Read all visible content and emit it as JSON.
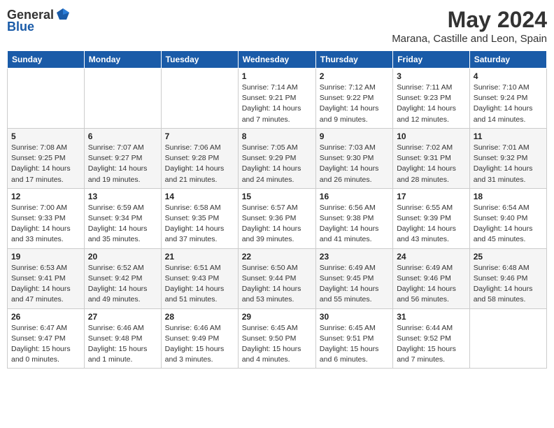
{
  "header": {
    "logo_general": "General",
    "logo_blue": "Blue",
    "month_year": "May 2024",
    "location": "Marana, Castille and Leon, Spain"
  },
  "weekdays": [
    "Sunday",
    "Monday",
    "Tuesday",
    "Wednesday",
    "Thursday",
    "Friday",
    "Saturday"
  ],
  "weeks": [
    [
      {
        "day": "",
        "sunrise": "",
        "sunset": "",
        "daylight": ""
      },
      {
        "day": "",
        "sunrise": "",
        "sunset": "",
        "daylight": ""
      },
      {
        "day": "",
        "sunrise": "",
        "sunset": "",
        "daylight": ""
      },
      {
        "day": "1",
        "sunrise": "Sunrise: 7:14 AM",
        "sunset": "Sunset: 9:21 PM",
        "daylight": "Daylight: 14 hours and 7 minutes."
      },
      {
        "day": "2",
        "sunrise": "Sunrise: 7:12 AM",
        "sunset": "Sunset: 9:22 PM",
        "daylight": "Daylight: 14 hours and 9 minutes."
      },
      {
        "day": "3",
        "sunrise": "Sunrise: 7:11 AM",
        "sunset": "Sunset: 9:23 PM",
        "daylight": "Daylight: 14 hours and 12 minutes."
      },
      {
        "day": "4",
        "sunrise": "Sunrise: 7:10 AM",
        "sunset": "Sunset: 9:24 PM",
        "daylight": "Daylight: 14 hours and 14 minutes."
      }
    ],
    [
      {
        "day": "5",
        "sunrise": "Sunrise: 7:08 AM",
        "sunset": "Sunset: 9:25 PM",
        "daylight": "Daylight: 14 hours and 17 minutes."
      },
      {
        "day": "6",
        "sunrise": "Sunrise: 7:07 AM",
        "sunset": "Sunset: 9:27 PM",
        "daylight": "Daylight: 14 hours and 19 minutes."
      },
      {
        "day": "7",
        "sunrise": "Sunrise: 7:06 AM",
        "sunset": "Sunset: 9:28 PM",
        "daylight": "Daylight: 14 hours and 21 minutes."
      },
      {
        "day": "8",
        "sunrise": "Sunrise: 7:05 AM",
        "sunset": "Sunset: 9:29 PM",
        "daylight": "Daylight: 14 hours and 24 minutes."
      },
      {
        "day": "9",
        "sunrise": "Sunrise: 7:03 AM",
        "sunset": "Sunset: 9:30 PM",
        "daylight": "Daylight: 14 hours and 26 minutes."
      },
      {
        "day": "10",
        "sunrise": "Sunrise: 7:02 AM",
        "sunset": "Sunset: 9:31 PM",
        "daylight": "Daylight: 14 hours and 28 minutes."
      },
      {
        "day": "11",
        "sunrise": "Sunrise: 7:01 AM",
        "sunset": "Sunset: 9:32 PM",
        "daylight": "Daylight: 14 hours and 31 minutes."
      }
    ],
    [
      {
        "day": "12",
        "sunrise": "Sunrise: 7:00 AM",
        "sunset": "Sunset: 9:33 PM",
        "daylight": "Daylight: 14 hours and 33 minutes."
      },
      {
        "day": "13",
        "sunrise": "Sunrise: 6:59 AM",
        "sunset": "Sunset: 9:34 PM",
        "daylight": "Daylight: 14 hours and 35 minutes."
      },
      {
        "day": "14",
        "sunrise": "Sunrise: 6:58 AM",
        "sunset": "Sunset: 9:35 PM",
        "daylight": "Daylight: 14 hours and 37 minutes."
      },
      {
        "day": "15",
        "sunrise": "Sunrise: 6:57 AM",
        "sunset": "Sunset: 9:36 PM",
        "daylight": "Daylight: 14 hours and 39 minutes."
      },
      {
        "day": "16",
        "sunrise": "Sunrise: 6:56 AM",
        "sunset": "Sunset: 9:38 PM",
        "daylight": "Daylight: 14 hours and 41 minutes."
      },
      {
        "day": "17",
        "sunrise": "Sunrise: 6:55 AM",
        "sunset": "Sunset: 9:39 PM",
        "daylight": "Daylight: 14 hours and 43 minutes."
      },
      {
        "day": "18",
        "sunrise": "Sunrise: 6:54 AM",
        "sunset": "Sunset: 9:40 PM",
        "daylight": "Daylight: 14 hours and 45 minutes."
      }
    ],
    [
      {
        "day": "19",
        "sunrise": "Sunrise: 6:53 AM",
        "sunset": "Sunset: 9:41 PM",
        "daylight": "Daylight: 14 hours and 47 minutes."
      },
      {
        "day": "20",
        "sunrise": "Sunrise: 6:52 AM",
        "sunset": "Sunset: 9:42 PM",
        "daylight": "Daylight: 14 hours and 49 minutes."
      },
      {
        "day": "21",
        "sunrise": "Sunrise: 6:51 AM",
        "sunset": "Sunset: 9:43 PM",
        "daylight": "Daylight: 14 hours and 51 minutes."
      },
      {
        "day": "22",
        "sunrise": "Sunrise: 6:50 AM",
        "sunset": "Sunset: 9:44 PM",
        "daylight": "Daylight: 14 hours and 53 minutes."
      },
      {
        "day": "23",
        "sunrise": "Sunrise: 6:49 AM",
        "sunset": "Sunset: 9:45 PM",
        "daylight": "Daylight: 14 hours and 55 minutes."
      },
      {
        "day": "24",
        "sunrise": "Sunrise: 6:49 AM",
        "sunset": "Sunset: 9:46 PM",
        "daylight": "Daylight: 14 hours and 56 minutes."
      },
      {
        "day": "25",
        "sunrise": "Sunrise: 6:48 AM",
        "sunset": "Sunset: 9:46 PM",
        "daylight": "Daylight: 14 hours and 58 minutes."
      }
    ],
    [
      {
        "day": "26",
        "sunrise": "Sunrise: 6:47 AM",
        "sunset": "Sunset: 9:47 PM",
        "daylight": "Daylight: 15 hours and 0 minutes."
      },
      {
        "day": "27",
        "sunrise": "Sunrise: 6:46 AM",
        "sunset": "Sunset: 9:48 PM",
        "daylight": "Daylight: 15 hours and 1 minute."
      },
      {
        "day": "28",
        "sunrise": "Sunrise: 6:46 AM",
        "sunset": "Sunset: 9:49 PM",
        "daylight": "Daylight: 15 hours and 3 minutes."
      },
      {
        "day": "29",
        "sunrise": "Sunrise: 6:45 AM",
        "sunset": "Sunset: 9:50 PM",
        "daylight": "Daylight: 15 hours and 4 minutes."
      },
      {
        "day": "30",
        "sunrise": "Sunrise: 6:45 AM",
        "sunset": "Sunset: 9:51 PM",
        "daylight": "Daylight: 15 hours and 6 minutes."
      },
      {
        "day": "31",
        "sunrise": "Sunrise: 6:44 AM",
        "sunset": "Sunset: 9:52 PM",
        "daylight": "Daylight: 15 hours and 7 minutes."
      },
      {
        "day": "",
        "sunrise": "",
        "sunset": "",
        "daylight": ""
      }
    ]
  ]
}
